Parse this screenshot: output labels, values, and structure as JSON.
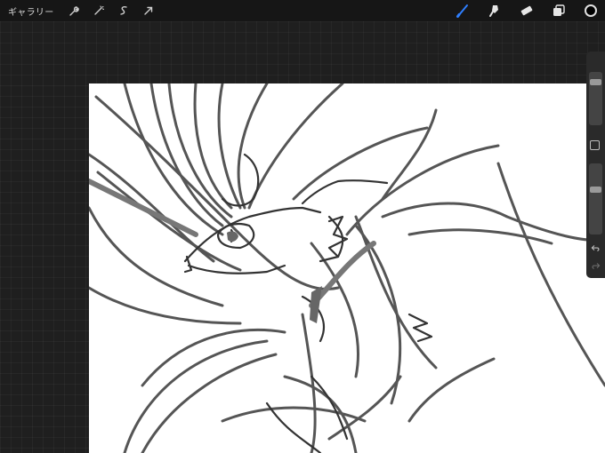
{
  "toolbar": {
    "gallery_label": "ギャラリー",
    "left_tools": [
      {
        "name": "wrench-icon"
      },
      {
        "name": "magic-wand-icon"
      },
      {
        "name": "selection-icon"
      },
      {
        "name": "transform-arrow-icon"
      }
    ],
    "right_tools": [
      {
        "name": "brush-icon",
        "active": true
      },
      {
        "name": "smudge-icon"
      },
      {
        "name": "eraser-icon"
      },
      {
        "name": "layers-icon"
      },
      {
        "name": "color-swatch"
      }
    ],
    "current_color": "#000000",
    "accent_color": "#2f7fff"
  },
  "sidebar": {
    "brush_size_level": 0.15,
    "opacity_level": 0.35,
    "modifier": "square-modifier-icon",
    "undo": "undo-icon",
    "redo": "redo-icon"
  }
}
